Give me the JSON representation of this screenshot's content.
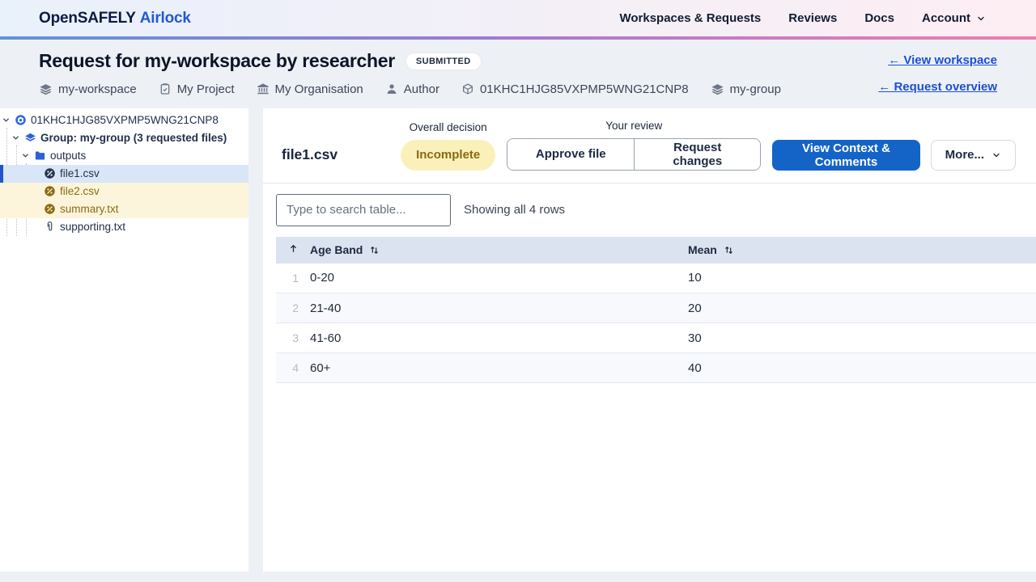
{
  "nav": {
    "brand": {
      "primary": "OpenSAFELY",
      "secondary": "Airlock"
    },
    "items": [
      {
        "label": "Workspaces & Requests"
      },
      {
        "label": "Reviews"
      },
      {
        "label": "Docs"
      },
      {
        "label": "Account"
      }
    ]
  },
  "header": {
    "title": "Request for my-workspace by researcher",
    "status_badge": "SUBMITTED",
    "links": [
      {
        "label": "← View workspace"
      },
      {
        "label": "← Request overview"
      }
    ],
    "meta": [
      {
        "icon": "layers-icon",
        "label": "my-workspace"
      },
      {
        "icon": "clipboard-icon",
        "label": "My Project"
      },
      {
        "icon": "bank-icon",
        "label": "My Organisation"
      },
      {
        "icon": "user-icon",
        "label": "Author"
      },
      {
        "icon": "cube-icon",
        "label": "01KHC1HJG85VXPMP5WNG21CNP8"
      },
      {
        "icon": "layers-icon",
        "label": "my-group"
      }
    ]
  },
  "sidebar": {
    "tree": {
      "root": {
        "label": "01KHC1HJG85VXPMP5WNG21CNP8"
      },
      "group": {
        "label": "Group: my-group (3 requested files)"
      },
      "folder": {
        "label": "outputs"
      },
      "files": [
        {
          "label": "file1.csv",
          "state": "selected"
        },
        {
          "label": "file2.csv",
          "state": "warning"
        },
        {
          "label": "summary.txt",
          "state": "warning"
        },
        {
          "label": "supporting.txt",
          "state": "default"
        }
      ]
    }
  },
  "main": {
    "file_header": {
      "title": "file1.csv",
      "decision_label": "Overall decision",
      "decision_value": "Incomplete",
      "review_label": "Your review",
      "approve_label": "Approve file",
      "request_label": "Request changes",
      "context_label": "View Context & Comments",
      "more_label": "More..."
    },
    "search": {
      "placeholder": "Type to search table...",
      "showing": "Showing all 4 rows"
    },
    "table": {
      "columns": [
        "Age Band",
        "Mean"
      ],
      "rows": [
        {
          "n": "1",
          "band": "0-20",
          "mean": "10"
        },
        {
          "n": "2",
          "band": "21-40",
          "mean": "20"
        },
        {
          "n": "3",
          "band": "41-60",
          "mean": "30"
        },
        {
          "n": "4",
          "band": "60+",
          "mean": "40"
        }
      ]
    }
  },
  "colors": {
    "brand_navy": "#0d1b43",
    "brand_blue": "#2158d8",
    "link_blue": "#1d4ed8",
    "primary_button_blue": "#1464c8",
    "selected_row_bg": "#d9e6f7",
    "selected_bar": "#2353c5",
    "warning_row_bg": "#fcf5dc",
    "warning_text": "#8d6a12",
    "decision_badge_bg": "#faf0ba",
    "decision_badge_text": "#8a6a10",
    "table_header_bg": "#dce3f0",
    "nav_gradient_bar": [
      "#5f93d8",
      "#9b7bd6",
      "#ee80ab"
    ]
  }
}
